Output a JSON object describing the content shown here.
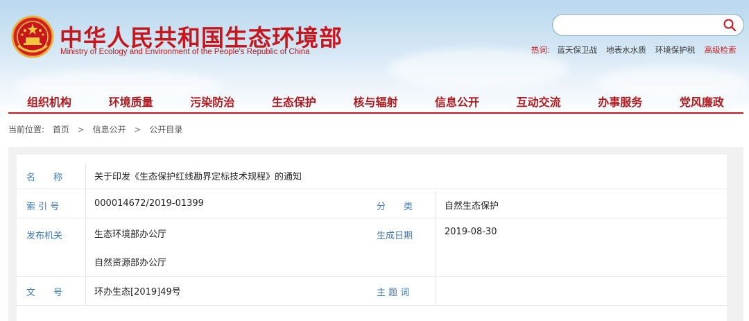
{
  "header": {
    "title": "中华人民共和国生态环境部",
    "subtitle": "Ministry of Ecology and Environment of the People's Republic of China",
    "emblem_icon": "national-emblem-icon",
    "search": {
      "placeholder": "",
      "icon": "search-icon"
    },
    "hotwords_label": "热词:",
    "hotwords": [
      "蓝天保卫战",
      "地表水水质",
      "环境保护税"
    ],
    "advanced_search": "高级检索"
  },
  "nav": {
    "items": [
      "组织机构",
      "环境质量",
      "污染防治",
      "生态保护",
      "核与辐射",
      "信息公开",
      "互动交流",
      "办事服务",
      "党风廉政"
    ]
  },
  "breadcrumb": {
    "label": "当前位置:",
    "items": [
      "首页",
      "信息公开",
      "公开目录"
    ],
    "separator": ">"
  },
  "info": {
    "name_label": "名　　称",
    "name_value": "关于印发《生态保护红线勘界定标技术规程》的通知",
    "index_label": "索 引 号",
    "index_value": "000014672/2019-01399",
    "category_label": "分　　类",
    "category_value": "自然生态保护",
    "issuer_label": "发布机关",
    "issuer_values": [
      "生态环境部办公厅",
      "自然资源部办公厅"
    ],
    "date_label": "生成日期",
    "date_value": "2019-08-30",
    "doc_no_label": "文　　号",
    "doc_no_value": "环办生态[2019]49号",
    "subject_label": "主 题 词",
    "subject_value": ""
  },
  "colors": {
    "brand_red": "#c8161d",
    "label_blue": "#3d78b8",
    "header_sky": "#b9d8ee"
  }
}
